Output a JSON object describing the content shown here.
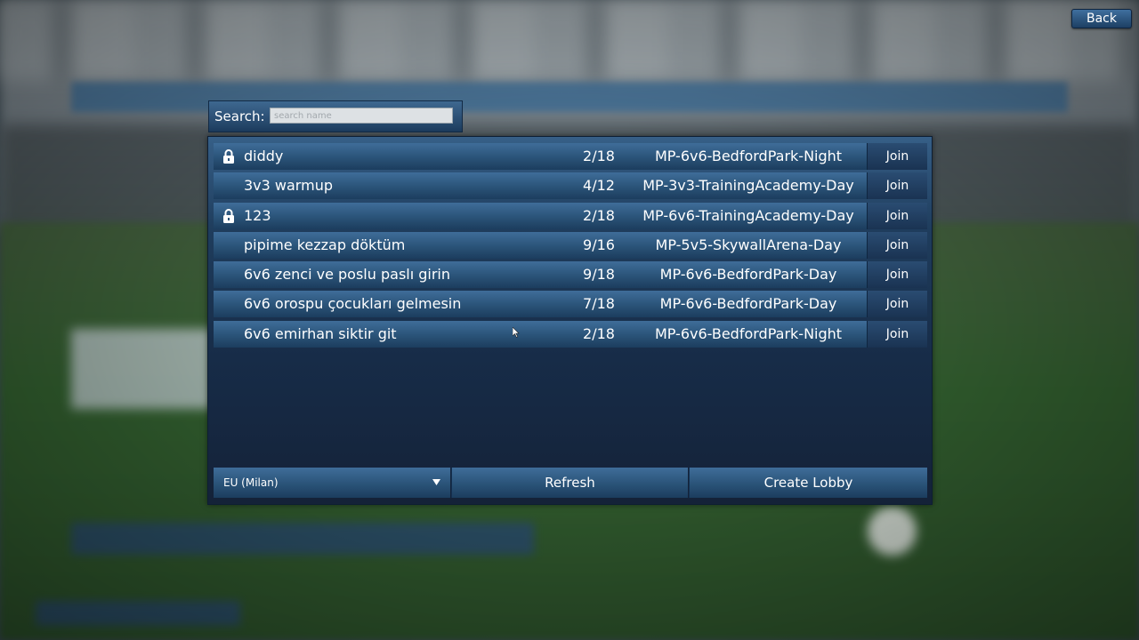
{
  "header": {
    "back_label": "Back"
  },
  "search": {
    "label": "Search:",
    "placeholder": "search name",
    "value": ""
  },
  "lobbies": [
    {
      "name": "diddy",
      "players": "2/18",
      "map": "MP-6v6-BedfordPark-Night",
      "locked": true,
      "join_label": "Join"
    },
    {
      "name": "3v3 warmup",
      "players": "4/12",
      "map": "MP-3v3-TrainingAcademy-Day",
      "locked": false,
      "join_label": "Join"
    },
    {
      "name": "123",
      "players": "2/18",
      "map": "MP-6v6-TrainingAcademy-Day",
      "locked": true,
      "join_label": "Join"
    },
    {
      "name": "pipime kezzap döktüm",
      "players": "9/16",
      "map": "MP-5v5-SkywallArena-Day",
      "locked": false,
      "join_label": "Join"
    },
    {
      "name": "6v6 zenci ve poslu paslı girin",
      "players": "9/18",
      "map": "MP-6v6-BedfordPark-Day",
      "locked": false,
      "join_label": "Join"
    },
    {
      "name": "6v6 orospu çocukları gelmesin",
      "players": "7/18",
      "map": "MP-6v6-BedfordPark-Day",
      "locked": false,
      "join_label": "Join"
    },
    {
      "name": "6v6 emirhan siktir git",
      "players": "2/18",
      "map": "MP-6v6-BedfordPark-Night",
      "locked": false,
      "join_label": "Join"
    }
  ],
  "footer": {
    "region": "EU (Milan)",
    "refresh_label": "Refresh",
    "create_label": "Create Lobby"
  },
  "icons": {
    "lock": "lock-icon",
    "dropdown": "chevron-down-icon",
    "cursor": "cursor-icon"
  },
  "colors": {
    "accent": "#2a5378",
    "button_dark": "#1a3352",
    "text": "#ffffff"
  }
}
